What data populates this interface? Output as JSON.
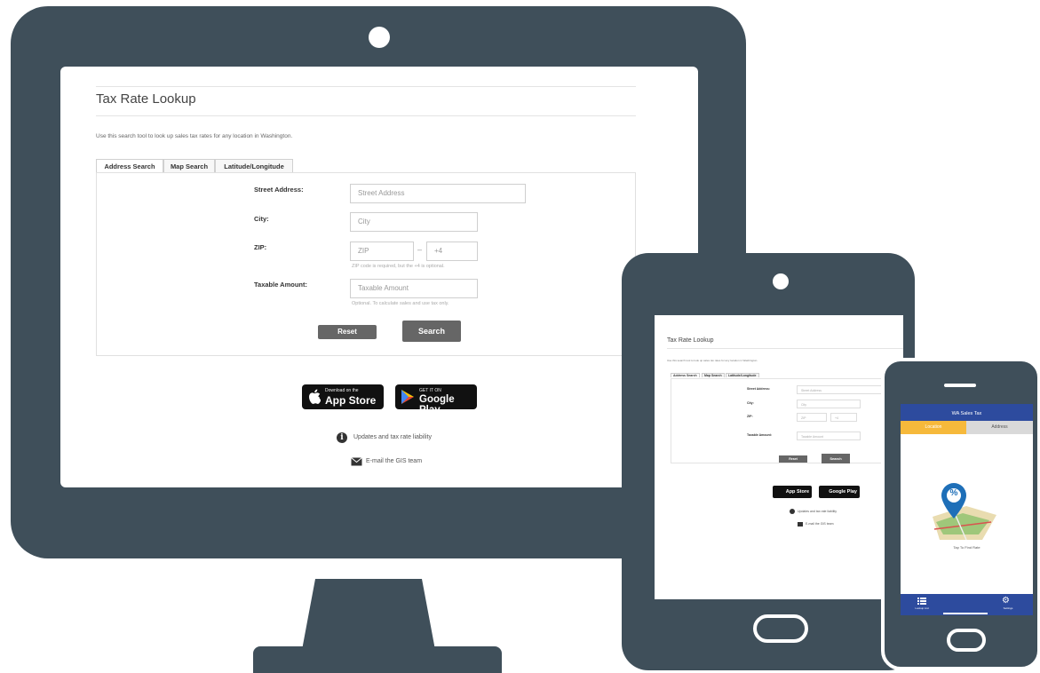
{
  "desktop": {
    "title": "Tax Rate Lookup",
    "intro": "Use this search tool to look up sales tax rates for any location in Washington.",
    "tabs": [
      "Address Search",
      "Map Search",
      "Latitude/Longitude"
    ],
    "form": {
      "street_label": "Street Address:",
      "street_placeholder": "Street Address",
      "city_label": "City:",
      "city_placeholder": "City",
      "zip_label": "ZIP:",
      "zip_placeholder": "ZIP",
      "zip_sep": "–",
      "zip4_placeholder": "+4",
      "zip_help": "ZIP code is required, but the +4 is optional.",
      "amount_label": "Taxable Amount:",
      "amount_placeholder": "Taxable Amount",
      "amount_help": "Optional. To calculate sales and use tax only.",
      "reset_label": "Reset",
      "search_label": "Search"
    },
    "app_store": {
      "line1": "Download on the",
      "line2": "App Store"
    },
    "google_play": {
      "line1": "GET IT ON",
      "line2": "Google Play"
    },
    "links": {
      "updates": "Updates and tax rate liability",
      "email": "E-mail the GIS team"
    }
  },
  "tablet": {
    "title": "Tax Rate Lookup",
    "intro": "Use this search tool to look up sales tax rates for any location in Washington.",
    "tabs": [
      "Address Search",
      "Map Search",
      "Latitude/Longitude"
    ],
    "labels": [
      "Street Address:",
      "City:",
      "ZIP:",
      "Taxable Amount:"
    ],
    "placeholders": [
      "Street Address",
      "City",
      "ZIP",
      "+4",
      "Taxable Amount"
    ],
    "reset_label": "Reset",
    "search_label": "Search",
    "app_store": "App Store",
    "google_play": "Google Play",
    "links": [
      "Updates and tax rate liability",
      "E-mail the GIS team"
    ]
  },
  "phone": {
    "app_title": "WA Sales Tax",
    "tabs": [
      "Location",
      "Address"
    ],
    "pin_symbol": "%",
    "caption": "Tap To Find Rate",
    "nav": [
      "Lookup List",
      "Settings"
    ]
  },
  "colors": {
    "device": "#3f4f5a",
    "button": "#666666",
    "phone_header": "#2d4b9e",
    "phone_tab_active": "#f6b93b",
    "pin": "#1e6fb8"
  },
  "icons": {
    "camera": "camera-icon",
    "apple": "apple-icon",
    "play": "play-icon",
    "info": "info-icon",
    "mail": "mail-icon",
    "list": "list-icon",
    "gear": "gear-icon",
    "home": "home-button-icon"
  }
}
